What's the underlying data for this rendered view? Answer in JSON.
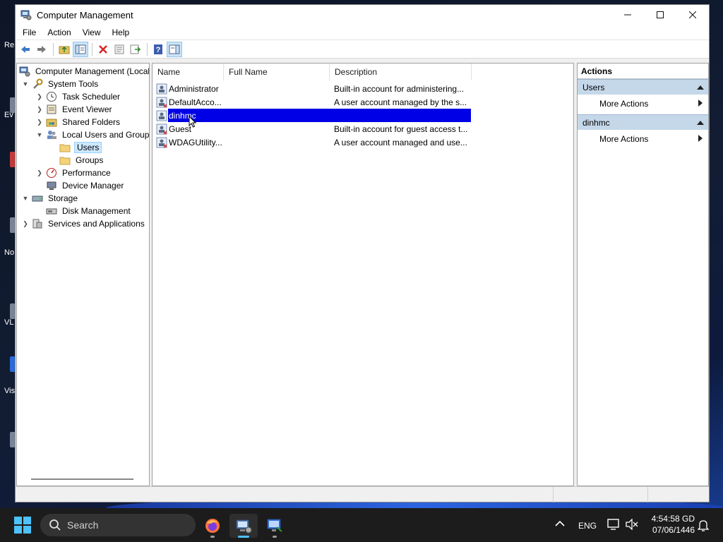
{
  "window": {
    "title": "Computer Management"
  },
  "menu": [
    "File",
    "Action",
    "View",
    "Help"
  ],
  "toolbar": [
    "back-arrow-icon",
    "forward-arrow-icon",
    "up-folder-icon",
    "show-hide-tree-icon",
    "delete-icon",
    "properties-icon",
    "export-list-icon",
    "help-icon",
    "show-hide-action-pane-icon"
  ],
  "tree": {
    "root": "Computer Management (Local",
    "system_tools": "System Tools",
    "task_scheduler": "Task Scheduler",
    "event_viewer": "Event Viewer",
    "shared_folders": "Shared Folders",
    "local_users_groups": "Local Users and Groups",
    "users": "Users",
    "groups": "Groups",
    "performance": "Performance",
    "device_manager": "Device Manager",
    "storage": "Storage",
    "disk_management": "Disk Management",
    "services_apps": "Services and Applications"
  },
  "list": {
    "columns": [
      "Name",
      "Full Name",
      "Description"
    ],
    "rows": [
      {
        "name": "Administrator",
        "full_name": "",
        "description": "Built-in account for administering..."
      },
      {
        "name": "DefaultAcco...",
        "full_name": "",
        "description": "A user account managed by the s..."
      },
      {
        "name": "dinhmc",
        "full_name": "",
        "description": ""
      },
      {
        "name": "Guest",
        "full_name": "",
        "description": "Built-in account for guest access t..."
      },
      {
        "name": "WDAGUtility...",
        "full_name": "",
        "description": "A user account managed and use..."
      }
    ],
    "selected_row": 2
  },
  "actions": {
    "header": "Actions",
    "section1": "Users",
    "section1_item": "More Actions",
    "section2": "dinhmc",
    "section2_item": "More Actions"
  },
  "desktop": {
    "frag1": "Re",
    "frag2": "Ev",
    "frag3": "No",
    "frag4": "VL",
    "frag5": "Vis"
  },
  "taskbar": {
    "search_placeholder": "Search",
    "lang": "ENG",
    "time": "4:54:58 GD",
    "date": "07/06/1446"
  },
  "colors": {
    "selection": "#0000e6",
    "accent": "#4cc2ff",
    "action_section": "#c5d8ea"
  }
}
